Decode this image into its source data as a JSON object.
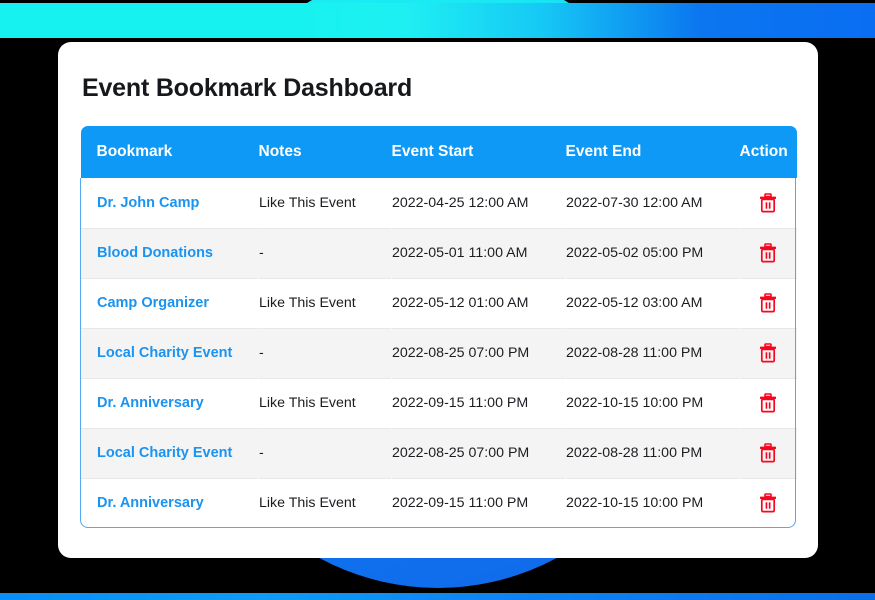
{
  "page": {
    "title": "Event Bookmark Dashboard",
    "background_color": "#000000",
    "card_color": "#ffffff",
    "accent_color": "#0d99f5",
    "link_color": "#1b93f0",
    "danger_color": "#f6071f",
    "gradient_start": "#16f2ef",
    "gradient_end": "#0a6ef2"
  },
  "table": {
    "columns": [
      {
        "key": "bookmark",
        "label": "Bookmark"
      },
      {
        "key": "notes",
        "label": "Notes"
      },
      {
        "key": "start",
        "label": "Event Start"
      },
      {
        "key": "end",
        "label": "Event End"
      },
      {
        "key": "action",
        "label": "Action"
      }
    ],
    "action_icon": "trash-icon",
    "rows": [
      {
        "bookmark": "Dr. John Camp",
        "notes": "Like This Event",
        "start": "2022-04-25 12:00 AM",
        "end": "2022-07-30 12:00 AM"
      },
      {
        "bookmark": "Blood Donations",
        "notes": "-",
        "start": "2022-05-01 11:00 AM",
        "end": "2022-05-02 05:00 PM"
      },
      {
        "bookmark": "Camp Organizer",
        "notes": "Like This Event",
        "start": "2022-05-12 01:00 AM",
        "end": "2022-05-12 03:00 AM"
      },
      {
        "bookmark": "Local Charity Event",
        "notes": "-",
        "start": "2022-08-25 07:00 PM",
        "end": "2022-08-28 11:00 PM"
      },
      {
        "bookmark": "Dr. Anniversary",
        "notes": "Like This Event",
        "start": "2022-09-15 11:00 PM",
        "end": "2022-10-15 10:00 PM"
      },
      {
        "bookmark": "Local Charity Event",
        "notes": "-",
        "start": "2022-08-25 07:00 PM",
        "end": "2022-08-28 11:00 PM"
      },
      {
        "bookmark": "Dr. Anniversary",
        "notes": "Like This Event",
        "start": "2022-09-15 11:00 PM",
        "end": "2022-10-15 10:00 PM"
      }
    ]
  }
}
